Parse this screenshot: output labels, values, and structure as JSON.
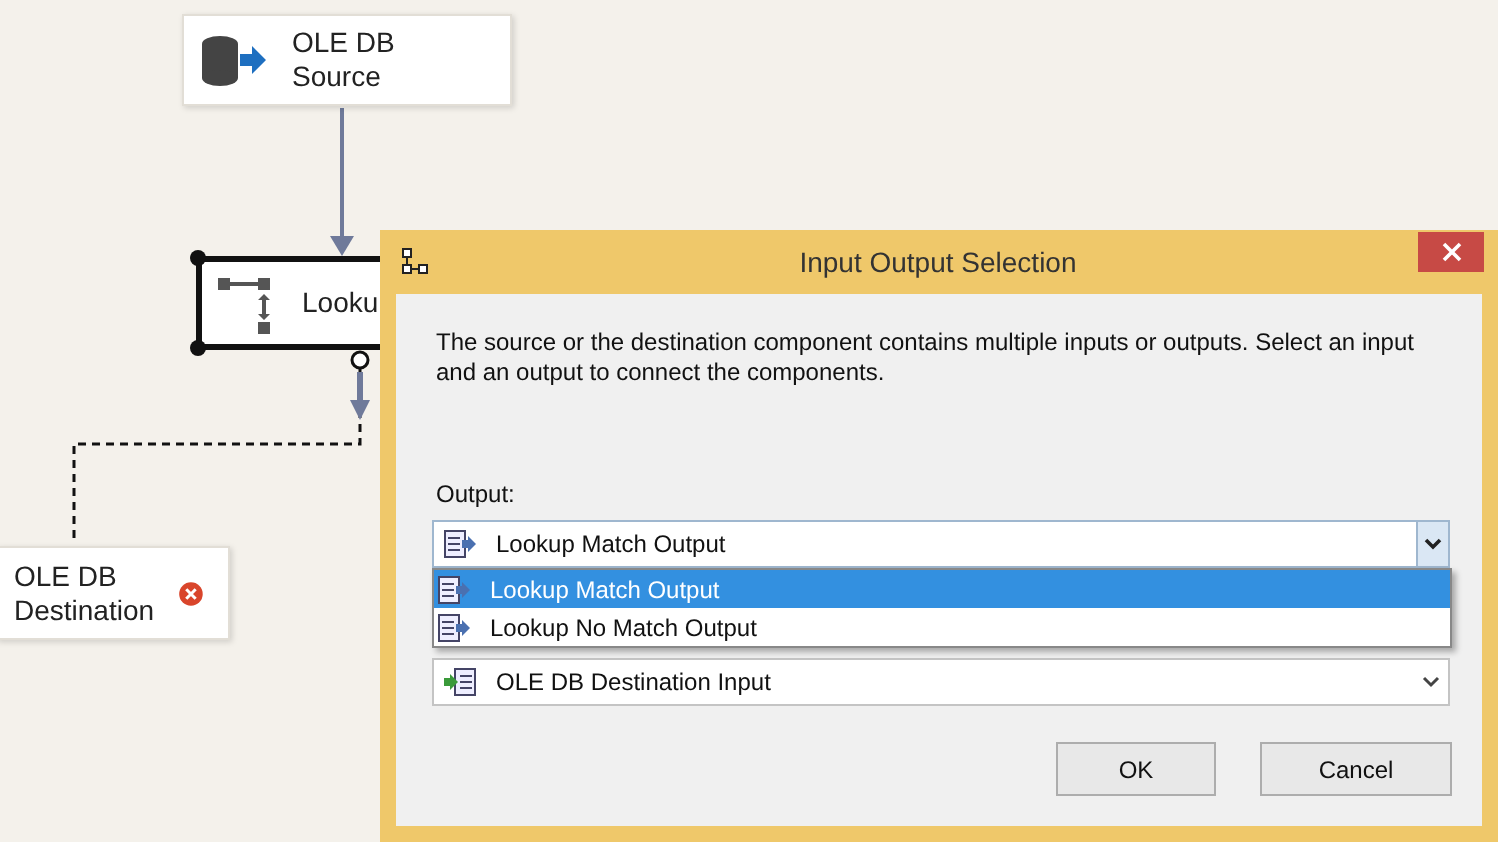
{
  "canvas": {
    "nodes": [
      {
        "kind": "source",
        "label": "OLE DB Source",
        "selected": false,
        "error": false
      },
      {
        "kind": "lookup",
        "label": "Looku",
        "selected": true,
        "error": false
      },
      {
        "kind": "destination",
        "label": "OLE DB Destination",
        "selected": false,
        "error": true
      }
    ]
  },
  "dialog": {
    "title": "Input Output Selection",
    "message": "The source or the destination component contains multiple inputs or outputs. Select an input and an output to connect the components.",
    "output": {
      "label": "Output:",
      "value": "Lookup Match Output",
      "expanded": true,
      "options": [
        {
          "label": "Lookup Match Output",
          "selected": true
        },
        {
          "label": "Lookup No Match Output",
          "selected": false
        }
      ]
    },
    "input": {
      "value": "OLE DB Destination Input"
    },
    "buttons": [
      "OK",
      "Cancel"
    ]
  }
}
